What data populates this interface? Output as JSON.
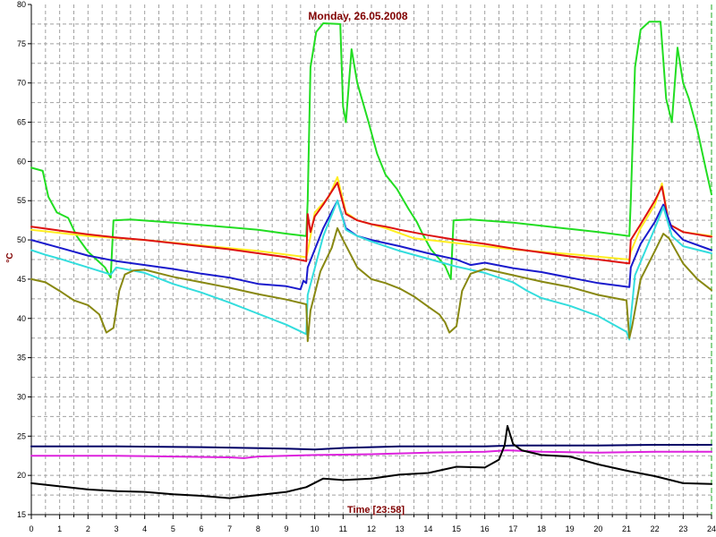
{
  "chart_data": {
    "type": "line",
    "title": "Monday, 26.05.2008",
    "xlabel": "Time [23:58]",
    "ylabel": "°C",
    "xlim": [
      0,
      24
    ],
    "ylim": [
      15,
      80
    ],
    "xticks": [
      "0",
      "1",
      "2",
      "3",
      "4",
      "5",
      "6",
      "7",
      "8",
      "9",
      "10",
      "11",
      "12",
      "13",
      "14",
      "15",
      "16",
      "17",
      "18",
      "19",
      "20",
      "21",
      "22",
      "23",
      "24"
    ],
    "yticks": [
      "15",
      "20",
      "25",
      "30",
      "35",
      "40",
      "45",
      "50",
      "55",
      "60",
      "65",
      "70",
      "75",
      "80"
    ],
    "grid": true,
    "series": [
      {
        "color": "#22dd22",
        "points": [
          [
            0,
            59.2
          ],
          [
            0.4,
            58.8
          ],
          [
            0.6,
            55.5
          ],
          [
            0.9,
            53.5
          ],
          [
            1.3,
            52.8
          ],
          [
            1.6,
            50.5
          ],
          [
            1.8,
            49.5
          ],
          [
            2.0,
            48.5
          ],
          [
            2.3,
            47.5
          ],
          [
            2.6,
            46.5
          ],
          [
            2.8,
            45.2
          ],
          [
            2.9,
            52.5
          ],
          [
            3.5,
            52.6
          ],
          [
            5,
            52.2
          ],
          [
            6,
            51.9
          ],
          [
            7,
            51.6
          ],
          [
            8,
            51.3
          ],
          [
            9,
            50.8
          ],
          [
            9.7,
            50.5
          ],
          [
            9.75,
            55
          ],
          [
            9.85,
            72
          ],
          [
            10.05,
            76.5
          ],
          [
            10.3,
            77.6
          ],
          [
            10.9,
            77.5
          ],
          [
            11.0,
            67
          ],
          [
            11.1,
            65
          ],
          [
            11.3,
            74.3
          ],
          [
            11.5,
            70
          ],
          [
            11.9,
            65
          ],
          [
            12.2,
            61
          ],
          [
            12.5,
            58.3
          ],
          [
            12.9,
            56.5
          ],
          [
            13.3,
            54
          ],
          [
            13.6,
            52.3
          ],
          [
            13.8,
            50.8
          ],
          [
            14.1,
            48.8
          ],
          [
            14.6,
            46.7
          ],
          [
            14.8,
            45
          ],
          [
            14.9,
            52.5
          ],
          [
            15.5,
            52.6
          ],
          [
            17,
            52.2
          ],
          [
            18,
            51.8
          ],
          [
            19,
            51.4
          ],
          [
            20,
            51.0
          ],
          [
            21.1,
            50.5
          ],
          [
            21.15,
            55
          ],
          [
            21.3,
            72
          ],
          [
            21.5,
            76.8
          ],
          [
            21.8,
            77.8
          ],
          [
            22.2,
            77.8
          ],
          [
            22.4,
            68
          ],
          [
            22.6,
            65
          ],
          [
            22.8,
            74.5
          ],
          [
            23.0,
            70
          ],
          [
            23.2,
            68
          ],
          [
            23.5,
            64
          ],
          [
            23.8,
            59
          ],
          [
            24,
            55.8
          ]
        ]
      },
      {
        "color": "#ffee22",
        "points": [
          [
            0,
            51.3
          ],
          [
            2,
            50.5
          ],
          [
            4,
            50.0
          ],
          [
            6,
            49.3
          ],
          [
            8,
            48.6
          ],
          [
            9.7,
            47.8
          ],
          [
            9.75,
            48.5
          ],
          [
            10.0,
            53.5
          ],
          [
            10.5,
            55.5
          ],
          [
            10.8,
            58
          ],
          [
            11.1,
            53.5
          ],
          [
            11.5,
            52.5
          ],
          [
            12.5,
            51.5
          ],
          [
            13.5,
            50.2
          ],
          [
            15,
            49.6
          ],
          [
            17,
            48.8
          ],
          [
            19,
            48.2
          ],
          [
            21.1,
            47.5
          ],
          [
            21.15,
            48.5
          ],
          [
            21.5,
            51.5
          ],
          [
            22.0,
            54.5
          ],
          [
            22.25,
            57.2
          ],
          [
            22.5,
            52
          ],
          [
            23,
            51
          ],
          [
            24,
            50.5
          ]
        ]
      },
      {
        "color": "#dd1111",
        "points": [
          [
            0,
            51.7
          ],
          [
            1,
            51.2
          ],
          [
            2,
            50.7
          ],
          [
            3,
            50.3
          ],
          [
            4,
            50.0
          ],
          [
            5,
            49.6
          ],
          [
            6,
            49.2
          ],
          [
            7,
            48.8
          ],
          [
            8,
            48.3
          ],
          [
            9,
            47.8
          ],
          [
            9.7,
            47.3
          ],
          [
            9.75,
            53.3
          ],
          [
            9.85,
            51
          ],
          [
            10.0,
            53
          ],
          [
            10.3,
            54.5
          ],
          [
            10.8,
            57.3
          ],
          [
            11.1,
            53.3
          ],
          [
            11.5,
            52.5
          ],
          [
            12,
            52
          ],
          [
            12.5,
            51.7
          ],
          [
            13,
            51.3
          ],
          [
            14,
            50.6
          ],
          [
            15,
            50.0
          ],
          [
            16,
            49.5
          ],
          [
            17,
            48.9
          ],
          [
            18,
            48.4
          ],
          [
            19,
            47.9
          ],
          [
            20,
            47.5
          ],
          [
            21.1,
            47.0
          ],
          [
            21.15,
            50
          ],
          [
            21.5,
            52
          ],
          [
            22.0,
            55
          ],
          [
            22.25,
            56.8
          ],
          [
            22.5,
            52
          ],
          [
            23,
            51
          ],
          [
            24,
            50.4
          ]
        ]
      },
      {
        "color": "#1a1acc",
        "points": [
          [
            0,
            50.0
          ],
          [
            1,
            49.0
          ],
          [
            2,
            48.0
          ],
          [
            3,
            47.3
          ],
          [
            4,
            46.8
          ],
          [
            5,
            46.3
          ],
          [
            6,
            45.7
          ],
          [
            7,
            45.2
          ],
          [
            8,
            44.4
          ],
          [
            9,
            44.1
          ],
          [
            9.5,
            43.7
          ],
          [
            9.6,
            44.8
          ],
          [
            9.7,
            44.5
          ],
          [
            9.75,
            46.5
          ],
          [
            10.3,
            51.5
          ],
          [
            10.8,
            55
          ],
          [
            11.1,
            51.5
          ],
          [
            11.5,
            50.5
          ],
          [
            12,
            50
          ],
          [
            13,
            49.2
          ],
          [
            14,
            48.3
          ],
          [
            15,
            47.5
          ],
          [
            15.5,
            46.8
          ],
          [
            16,
            47.1
          ],
          [
            17,
            46.4
          ],
          [
            18,
            45.9
          ],
          [
            19,
            45.2
          ],
          [
            20,
            44.5
          ],
          [
            21.1,
            44
          ],
          [
            21.15,
            46.5
          ],
          [
            21.5,
            49.5
          ],
          [
            22.0,
            52.3
          ],
          [
            22.3,
            54.5
          ],
          [
            22.6,
            51.5
          ],
          [
            23,
            50
          ],
          [
            24,
            48.7
          ]
        ]
      },
      {
        "color": "#33dddd",
        "points": [
          [
            0,
            48.7
          ],
          [
            0.5,
            48.1
          ],
          [
            1,
            47.6
          ],
          [
            2,
            46.5
          ],
          [
            2.8,
            45.6
          ],
          [
            3,
            46.5
          ],
          [
            4,
            45.8
          ],
          [
            5,
            44.4
          ],
          [
            6,
            43.3
          ],
          [
            7,
            42.0
          ],
          [
            8,
            40.6
          ],
          [
            9,
            39.2
          ],
          [
            9.7,
            38
          ],
          [
            9.75,
            43
          ],
          [
            10.3,
            50.5
          ],
          [
            10.8,
            55
          ],
          [
            11.1,
            51.3
          ],
          [
            11.5,
            50.5
          ],
          [
            12,
            49.8
          ],
          [
            13,
            48.6
          ],
          [
            14,
            47.6
          ],
          [
            15,
            46.6
          ],
          [
            16,
            45.8
          ],
          [
            17,
            44.6
          ],
          [
            17.5,
            43.5
          ],
          [
            18,
            42.6
          ],
          [
            19,
            41.6
          ],
          [
            20,
            40.3
          ],
          [
            21,
            38.3
          ],
          [
            21.1,
            37.3
          ],
          [
            21.15,
            40
          ],
          [
            21.3,
            45.5
          ],
          [
            22.0,
            51.5
          ],
          [
            22.3,
            54.2
          ],
          [
            22.6,
            50.5
          ],
          [
            23,
            49.2
          ],
          [
            24,
            48.3
          ]
        ]
      },
      {
        "color": "#888811",
        "points": [
          [
            0,
            45
          ],
          [
            0.5,
            44.6
          ],
          [
            1,
            43.5
          ],
          [
            1.5,
            42.3
          ],
          [
            2,
            41.7
          ],
          [
            2.4,
            40.5
          ],
          [
            2.65,
            38.2
          ],
          [
            2.9,
            38.8
          ],
          [
            3.1,
            43.5
          ],
          [
            3.3,
            45.6
          ],
          [
            3.6,
            46.1
          ],
          [
            4,
            46.2
          ],
          [
            5,
            45.3
          ],
          [
            6,
            44.6
          ],
          [
            7,
            43.9
          ],
          [
            8,
            43.1
          ],
          [
            9,
            42.4
          ],
          [
            9.7,
            41.8
          ],
          [
            9.75,
            37.1
          ],
          [
            9.85,
            41
          ],
          [
            10.2,
            46
          ],
          [
            10.6,
            49
          ],
          [
            10.8,
            51.5
          ],
          [
            11.0,
            50
          ],
          [
            11.5,
            46.5
          ],
          [
            12,
            45
          ],
          [
            12.5,
            44.5
          ],
          [
            13,
            43.8
          ],
          [
            13.5,
            42.8
          ],
          [
            14,
            41.5
          ],
          [
            14.4,
            40.5
          ],
          [
            14.6,
            39.5
          ],
          [
            14.75,
            38.2
          ],
          [
            15.0,
            39
          ],
          [
            15.2,
            43.5
          ],
          [
            15.5,
            45.7
          ],
          [
            16,
            46.3
          ],
          [
            17,
            45.5
          ],
          [
            18,
            44.7
          ],
          [
            19,
            44.0
          ],
          [
            20,
            43.0
          ],
          [
            21,
            42.3
          ],
          [
            21.1,
            37.5
          ],
          [
            21.2,
            39
          ],
          [
            21.5,
            45
          ],
          [
            22,
            48.6
          ],
          [
            22.3,
            50.8
          ],
          [
            22.5,
            50.2
          ],
          [
            23,
            47
          ],
          [
            23.5,
            45
          ],
          [
            24,
            43.6
          ]
        ]
      },
      {
        "color": "#000066",
        "points": [
          [
            0,
            23.7
          ],
          [
            3,
            23.7
          ],
          [
            6,
            23.6
          ],
          [
            9,
            23.4
          ],
          [
            10,
            23.3
          ],
          [
            11,
            23.5
          ],
          [
            13,
            23.7
          ],
          [
            16,
            23.7
          ],
          [
            17,
            23.8
          ],
          [
            20,
            23.8
          ],
          [
            22,
            23.9
          ],
          [
            24,
            23.9
          ]
        ]
      },
      {
        "color": "#dd22dd",
        "points": [
          [
            0,
            22.5
          ],
          [
            3,
            22.5
          ],
          [
            5,
            22.4
          ],
          [
            7,
            22.3
          ],
          [
            7.5,
            22.2
          ],
          [
            8,
            22.4
          ],
          [
            10,
            22.6
          ],
          [
            12,
            22.7
          ],
          [
            14,
            22.9
          ],
          [
            16,
            23.0
          ],
          [
            16.8,
            23.2
          ],
          [
            18,
            23.0
          ],
          [
            20,
            22.9
          ],
          [
            22,
            23.0
          ],
          [
            24,
            23.0
          ]
        ]
      },
      {
        "color": "#000000",
        "points": [
          [
            0,
            19.0
          ],
          [
            1,
            18.6
          ],
          [
            2,
            18.2
          ],
          [
            3,
            18.0
          ],
          [
            4,
            17.9
          ],
          [
            5,
            17.6
          ],
          [
            6,
            17.4
          ],
          [
            7,
            17.1
          ],
          [
            8,
            17.5
          ],
          [
            9,
            17.9
          ],
          [
            9.7,
            18.5
          ],
          [
            10.3,
            19.6
          ],
          [
            11,
            19.4
          ],
          [
            12,
            19.6
          ],
          [
            13,
            20.1
          ],
          [
            14,
            20.3
          ],
          [
            14.5,
            20.7
          ],
          [
            15,
            21.1
          ],
          [
            16,
            21.0
          ],
          [
            16.5,
            22.0
          ],
          [
            16.7,
            23.8
          ],
          [
            16.8,
            26.3
          ],
          [
            17.0,
            24
          ],
          [
            17.3,
            23.2
          ],
          [
            18,
            22.6
          ],
          [
            19,
            22.4
          ],
          [
            20,
            21.4
          ],
          [
            21,
            20.6
          ],
          [
            22,
            19.9
          ],
          [
            23,
            19.0
          ],
          [
            24,
            18.9
          ]
        ]
      }
    ]
  }
}
